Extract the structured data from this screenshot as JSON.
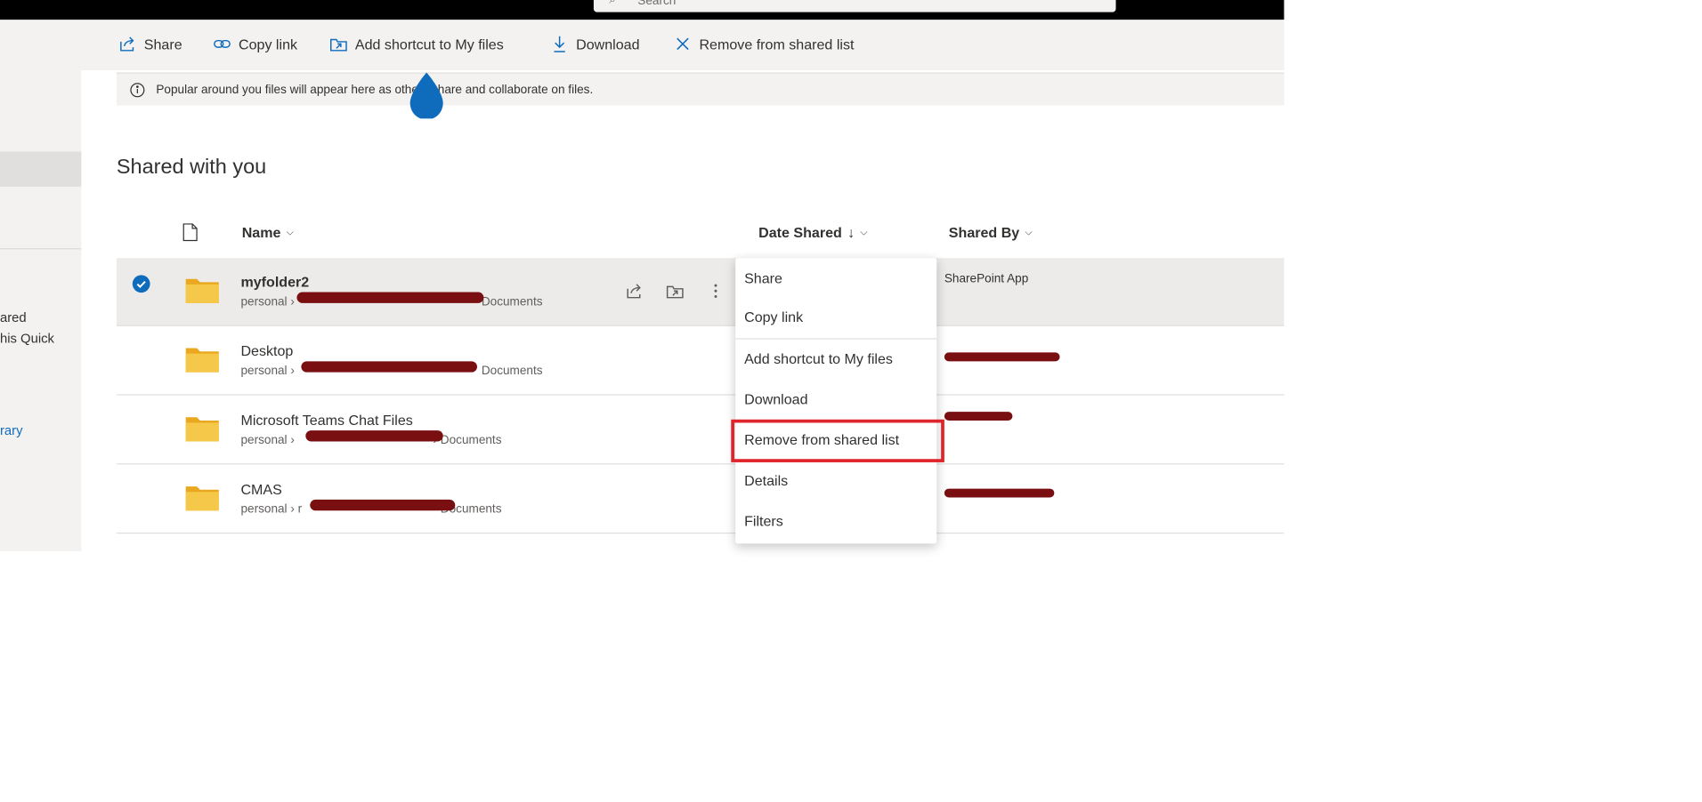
{
  "search": {
    "placeholder": "Search"
  },
  "sidebar": {
    "fragments": [
      "ared",
      "his Quick"
    ],
    "link_fragment": "rary"
  },
  "commands": {
    "share": "Share",
    "copy_link": "Copy link",
    "add_shortcut": "Add shortcut to My files",
    "download": "Download",
    "remove": "Remove from shared list"
  },
  "info": {
    "text": "Popular around you files will appear here as others share and collaborate on files."
  },
  "page": {
    "title": "Shared with you"
  },
  "columns": {
    "name": "Name",
    "date_shared": "Date Shared",
    "sort_arrow": "↓",
    "shared_by": "Shared By"
  },
  "rows": [
    {
      "name": "myfolder2",
      "path_start": "personal ›",
      "path_end": "Documents",
      "shared_by": "SharePoint App",
      "selected": true
    },
    {
      "name": "Desktop",
      "path_start": "personal ›",
      "path_end": "Documents",
      "shared_by": "",
      "selected": false
    },
    {
      "name": "Microsoft Teams Chat Files",
      "path_start": "personal ›",
      "path_end": "› Documents",
      "shared_by": "",
      "selected": false
    },
    {
      "name": "CMAS",
      "path_start": "personal › r",
      "path_end": "Documents",
      "shared_by": "",
      "selected": false
    }
  ],
  "context_menu": {
    "items": [
      "Share",
      "Copy link",
      "Add shortcut to My files",
      "Download",
      "Remove from shared list",
      "Details",
      "Filters"
    ],
    "highlighted_index": 4
  },
  "colors": {
    "accent": "#0f6cbd",
    "folder": "#f6c84a",
    "highlight_border": "#e0242b",
    "redaction": "#7a0f12"
  }
}
